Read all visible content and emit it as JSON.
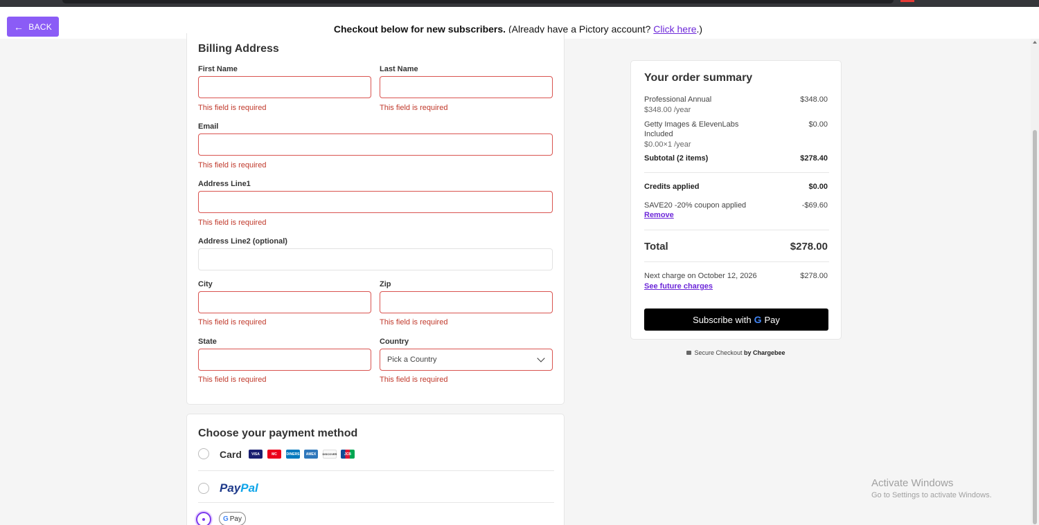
{
  "topbar": {
    "back_label": "BACK",
    "message_bold": "Checkout below for new subscribers.",
    "message_rest": " (Already have a Pictory account? ",
    "link_text": "Click here",
    "message_end": ".)"
  },
  "billing": {
    "title": "Billing Address",
    "first_name_label": "First Name",
    "last_name_label": "Last Name",
    "email_label": "Email",
    "address1_label": "Address Line1",
    "address2_label": "Address Line2 (optional)",
    "city_label": "City",
    "zip_label": "Zip",
    "state_label": "State",
    "country_label": "Country",
    "country_placeholder": "Pick a Country",
    "error_text": "This field is required"
  },
  "payment": {
    "title": "Choose your payment method",
    "card_label": "Card",
    "card_brands": [
      "VISA",
      "MC",
      "DINERS",
      "AMEX",
      "DISCOVER",
      "JCB"
    ],
    "paypal_pay": "Pay",
    "paypal_pal": "Pal",
    "gpay_label": "Pay"
  },
  "summary": {
    "title": "Your order summary",
    "items": [
      {
        "name": "Professional Annual",
        "detail": "$348.00 /year",
        "amount": "$348.00"
      },
      {
        "name": "Getty Images & ElevenLabs",
        "name2": "Included",
        "detail": "$0.00×1 /year",
        "amount": "$0.00"
      }
    ],
    "subtotal_label": "Subtotal (2 items)",
    "subtotal_amount": "$278.40",
    "credits_label": "Credits applied",
    "credits_amount": "$0.00",
    "coupon_label": "SAVE20 -20% coupon applied",
    "coupon_amount": "-$69.60",
    "remove_label": "Remove",
    "total_label": "Total",
    "total_amount": "$278.00",
    "next_charge_label": "Next charge on October 12, 2026",
    "next_charge_amount": "$278.00",
    "future_link": "See future charges",
    "subscribe_label": "Subscribe with",
    "subscribe_pay": "Pay",
    "secure_text": "Secure Checkout ",
    "secure_by": "by Chargebee"
  },
  "watermark": {
    "line1": "Activate Windows",
    "line2": "Go to Settings to activate Windows."
  },
  "colors": {
    "accent": "#8b5cf6",
    "error": "#d9534f",
    "link": "#6d28d9"
  }
}
